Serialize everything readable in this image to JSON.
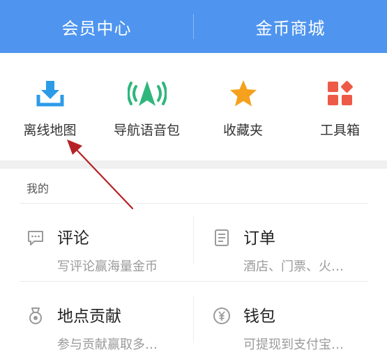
{
  "header": {
    "tabs": [
      {
        "label": "会员中心"
      },
      {
        "label": "金币商城"
      }
    ]
  },
  "quick_actions": [
    {
      "label": "离线地图",
      "icon": "download-icon",
      "color": "#2b9be8"
    },
    {
      "label": "导航语音包",
      "icon": "navigation-voice-icon",
      "color": "#2fb67c"
    },
    {
      "label": "收藏夹",
      "icon": "star-icon",
      "color": "#f5a11d"
    },
    {
      "label": "工具箱",
      "icon": "toolbox-icon",
      "color": "#ee5a48"
    }
  ],
  "mine": {
    "title": "我的",
    "items": [
      {
        "title": "评论",
        "desc": "写评论赢海量金币",
        "icon": "comment-icon"
      },
      {
        "title": "订单",
        "desc": "酒店、门票、火…",
        "icon": "order-icon"
      },
      {
        "title": "地点贡献",
        "desc": "参与贡献赢取多…",
        "icon": "medal-icon"
      },
      {
        "title": "钱包",
        "desc": "可提现到支付宝…",
        "icon": "yuan-coin-icon"
      }
    ]
  },
  "colors": {
    "header_bg": "#4f95ef",
    "annotation_arrow": "#b52226"
  }
}
